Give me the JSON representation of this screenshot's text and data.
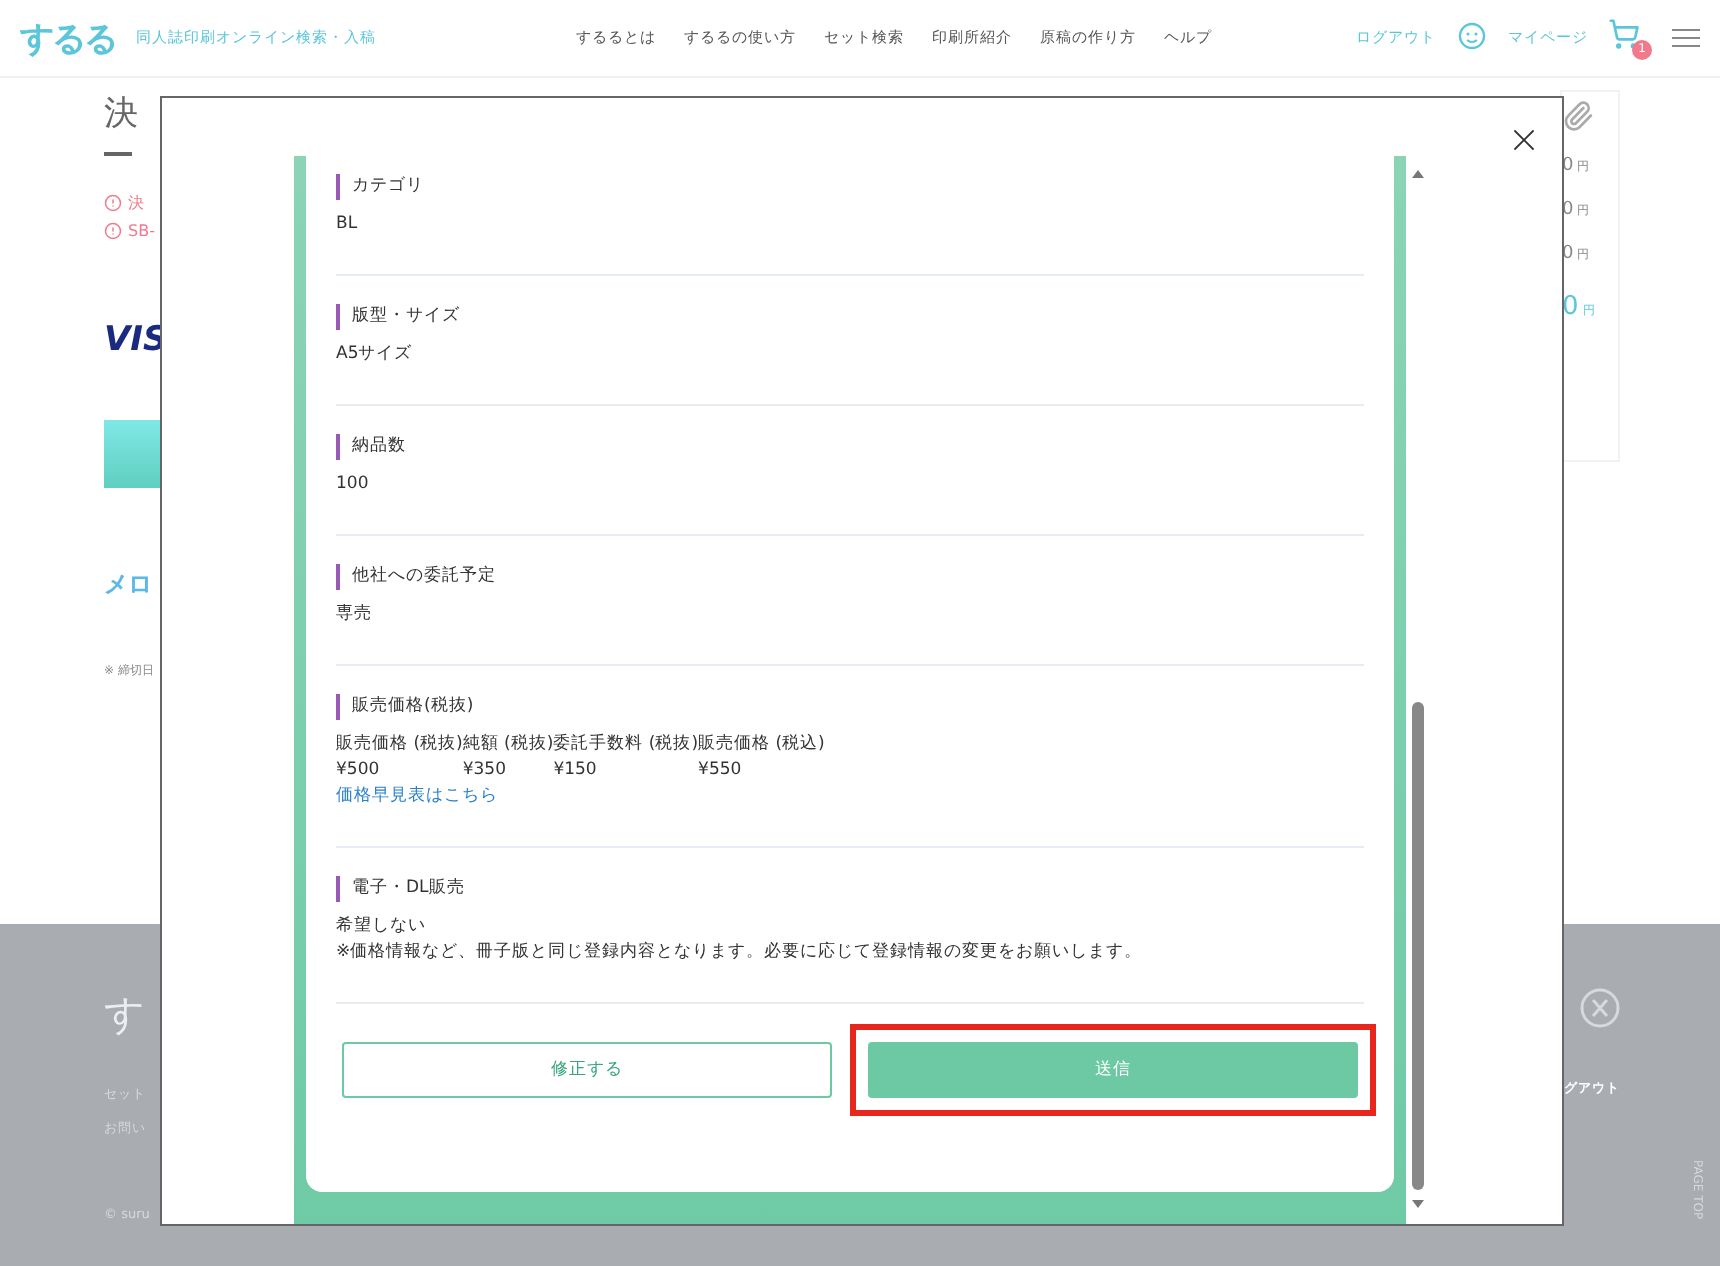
{
  "header": {
    "logo": "するる",
    "tagline": "同人誌印刷オンライン検索・入稿",
    "nav": [
      "するるとは",
      "するるの使い方",
      "セット検索",
      "印刷所紹介",
      "原稿の作り方",
      "ヘルプ"
    ],
    "logout": "ログアウト",
    "mypage": "マイページ",
    "cart_count": "1"
  },
  "background": {
    "title": "決",
    "warnings": [
      "決",
      "SB-"
    ],
    "card_brand": "VIS",
    "wallet_brand": "メロ",
    "note": "※ 締切日",
    "prices": [
      {
        "amount": "0",
        "unit": "円",
        "highlight": false
      },
      {
        "amount": "0",
        "unit": "円",
        "highlight": false
      },
      {
        "amount": "0",
        "unit": "円",
        "highlight": false
      },
      {
        "amount": "0",
        "unit": "円",
        "highlight": true
      }
    ]
  },
  "footer": {
    "logo": "す",
    "links": [
      "セット",
      "お問い"
    ],
    "copyright": "© suru",
    "logout": "グアウト",
    "page_top": "PAGE TOP"
  },
  "modal": {
    "sections": [
      {
        "kind": "text",
        "label": "カテゴリ",
        "lines": [
          "BL"
        ]
      },
      {
        "kind": "text",
        "label": "版型・サイズ",
        "lines": [
          "A5サイズ"
        ]
      },
      {
        "kind": "text",
        "label": "納品数",
        "lines": [
          "100"
        ]
      },
      {
        "kind": "text",
        "label": "他社への委託予定",
        "lines": [
          "専売"
        ]
      },
      {
        "kind": "price",
        "label": "販売価格(税抜)",
        "columns": [
          {
            "header": "販売価格 (税抜)",
            "value": "¥500"
          },
          {
            "header": "純額 (税抜)",
            "value": "¥350"
          },
          {
            "header": "委託手数料 (税抜)",
            "value": "¥150"
          },
          {
            "header": "販売価格 (税込)",
            "value": "¥550"
          }
        ],
        "link": "価格早見表はこちら"
      },
      {
        "kind": "text",
        "label": "電子・DL販売",
        "lines": [
          "希望しない",
          "※価格情報など、冊子版と同じ登録内容となります。必要に応じて登録情報の変更をお願いします。"
        ]
      }
    ],
    "buttons": [
      {
        "kind": "outline",
        "label": "修正する",
        "highlighted": false
      },
      {
        "kind": "primary",
        "label": "送信",
        "highlighted": true
      }
    ]
  }
}
